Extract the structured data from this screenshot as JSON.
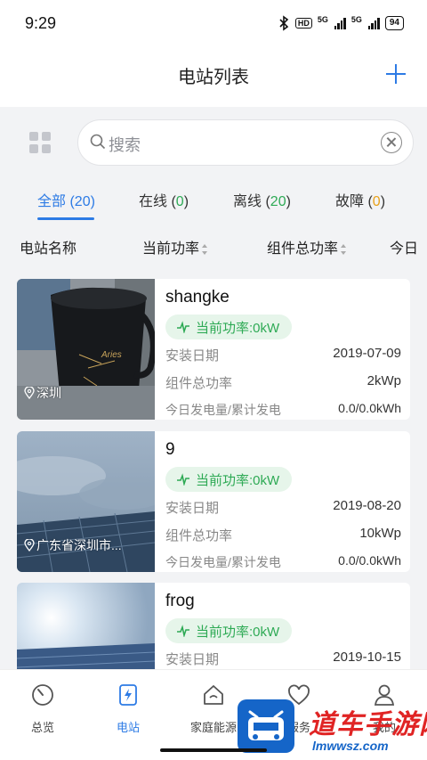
{
  "status_bar": {
    "time": "9:29",
    "hd_badge": "HD",
    "net1": "5G",
    "net2": "5G",
    "battery": "94"
  },
  "header": {
    "title": "电站列表"
  },
  "search": {
    "placeholder": "搜索"
  },
  "tabs": [
    {
      "label": "全部",
      "count": "20",
      "active": true
    },
    {
      "label": "在线",
      "count": "0"
    },
    {
      "label": "离线",
      "count": "20"
    },
    {
      "label": "故障",
      "count": "0"
    }
  ],
  "columns": [
    "电站名称",
    "当前功率",
    "组件总功率",
    "今日"
  ],
  "field_labels": {
    "install_date": "安装日期",
    "total_power": "组件总功率",
    "energy": "今日发电量/累计发电"
  },
  "stations": [
    {
      "name": "shangke",
      "current_power": "当前功率:0kW",
      "location": "深圳",
      "install_date": "2019-07-09",
      "total_power": "2kWp",
      "energy": "0.0/0.0kWh"
    },
    {
      "name": "9",
      "current_power": "当前功率:0kW",
      "location": "广东省深圳市...",
      "install_date": "2019-08-20",
      "total_power": "10kWp",
      "energy": "0.0/0.0kWh"
    },
    {
      "name": "frog",
      "current_power": "当前功率:0kW",
      "location": "",
      "install_date": "2019-10-15",
      "total_power": "",
      "energy": ""
    }
  ],
  "bottom_nav": [
    {
      "label": "总览",
      "icon": "overview-gauge-icon"
    },
    {
      "label": "电站",
      "icon": "station-bolt-icon",
      "active": true
    },
    {
      "label": "家庭能源",
      "icon": "home-energy-icon"
    },
    {
      "label": "服务",
      "icon": "service-heart-icon"
    },
    {
      "label": "我的",
      "icon": "profile-icon"
    }
  ],
  "watermark": {
    "text": "道车手游网",
    "url": "lmwwsz.com"
  },
  "colors": {
    "accent": "#2d7be5",
    "online": "#2eaa55",
    "fault": "#e8a11a"
  }
}
